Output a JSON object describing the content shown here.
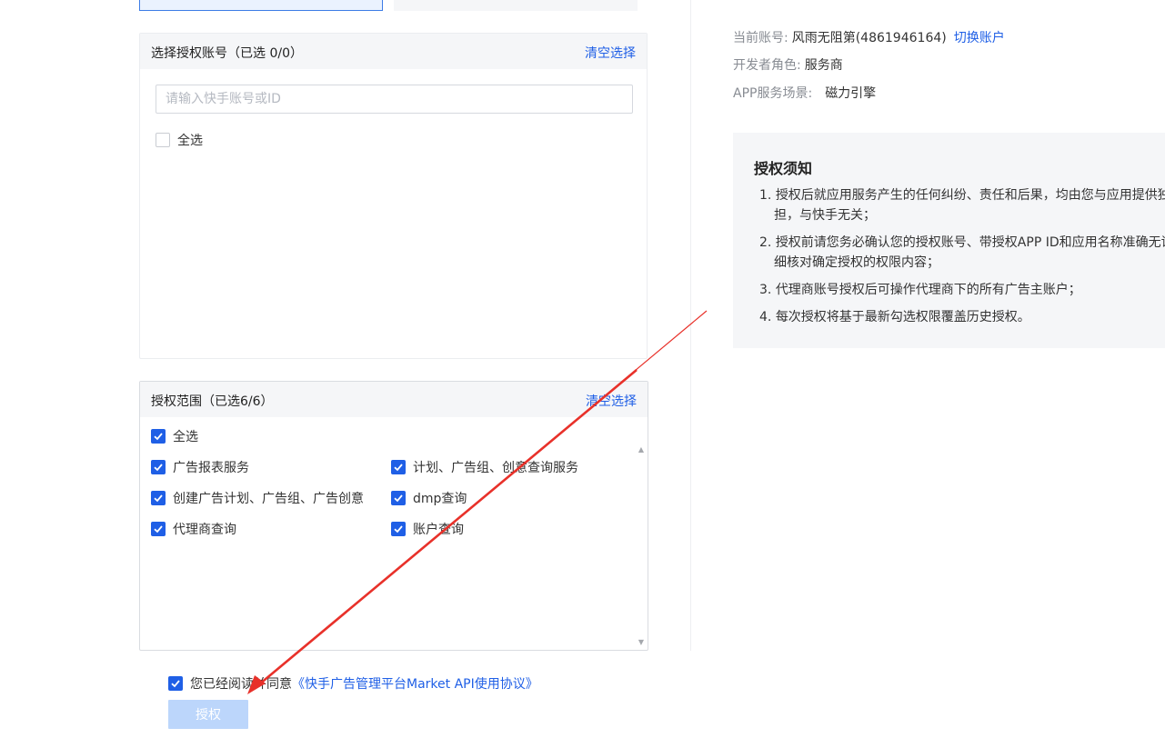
{
  "account_section": {
    "title": "选择授权账号（已选 0/0）",
    "clear_label": "清空选择",
    "search_placeholder": "请输入快手账号或ID",
    "select_all_label": "全选",
    "select_all_checked": false
  },
  "scope_section": {
    "title": "授权范围（已选6/6）",
    "clear_label": "清空选择",
    "select_all_label": "全选",
    "items": [
      {
        "label": "广告报表服务",
        "checked": true
      },
      {
        "label": "计划、广告组、创意查询服务",
        "checked": true
      },
      {
        "label": "创建广告计划、广告组、广告创意",
        "checked": true
      },
      {
        "label": "dmp查询",
        "checked": true
      },
      {
        "label": "代理商查询",
        "checked": true
      },
      {
        "label": "账户查询",
        "checked": true
      }
    ]
  },
  "account_info": {
    "current_account_key": "当前账号:",
    "current_account_value": "风雨无阻第(4861946164)",
    "switch_account_label": "切换账户",
    "developer_role_key": "开发者角色:",
    "developer_role_value": "服务商",
    "app_scene_key": "APP服务场景:",
    "app_scene_value": "磁力引擎"
  },
  "notice": {
    "title": "授权须知",
    "items": [
      {
        "num": "1.",
        "line1": "授权后就应用服务产生的任何纠纷、责任和后果，均由您与应用提供独",
        "line2": "担，与快手无关；"
      },
      {
        "num": "2.",
        "line1": "授权前请您务必确认您的授权账号、带授权APP ID和应用名称准确无误",
        "line2": "细核对确定授权的权限内容；"
      },
      {
        "num": "3.",
        "line1": "代理商账号授权后可操作代理商下的所有广告主账户；",
        "line2": ""
      },
      {
        "num": "4.",
        "line1": "每次授权将基于最新勾选权限覆盖历史授权。",
        "line2": ""
      }
    ]
  },
  "agreement": {
    "checked": true,
    "prefix": "您已经阅读并同意",
    "link_text": "《快手广告管理平台Market API使用协议》"
  },
  "authorize_button": {
    "label": "授权"
  },
  "colors": {
    "accent": "#1f5fe6",
    "annotation_arrow": "#e8312a",
    "button_disabled": "#bcd6fb"
  },
  "icons": [
    "checkbox-checked-icon",
    "checkbox-empty-icon",
    "scroll-up-icon",
    "scroll-down-icon",
    "annotation-arrow"
  ]
}
